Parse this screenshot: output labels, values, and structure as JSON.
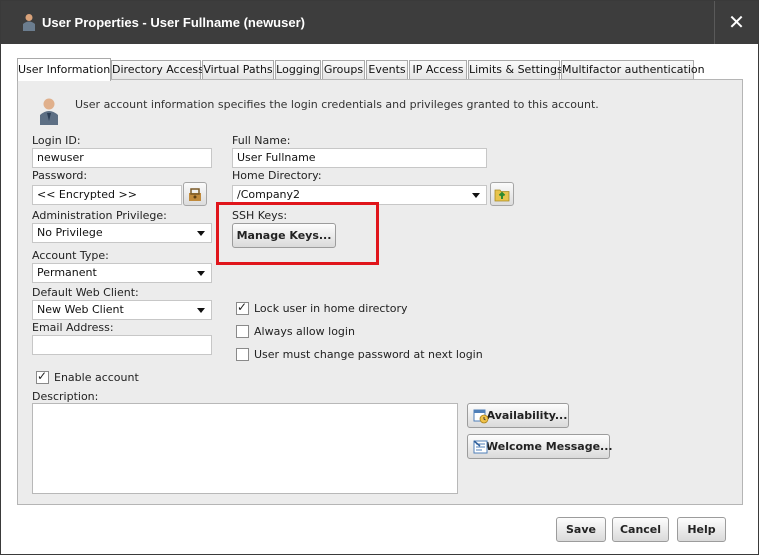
{
  "window": {
    "title": "User Properties - User Fullname (newuser)",
    "close_glyph": "✕"
  },
  "tabs": [
    {
      "label": "User Information",
      "active": true
    },
    {
      "label": "Directory Access"
    },
    {
      "label": "Virtual Paths"
    },
    {
      "label": "Logging"
    },
    {
      "label": "Groups"
    },
    {
      "label": "Events"
    },
    {
      "label": "IP Access"
    },
    {
      "label": "Limits & Settings"
    },
    {
      "label": "Multifactor authentication"
    }
  ],
  "info_text": "User account information specifies the login credentials and privileges granted to this account.",
  "form": {
    "login_id": {
      "label": "Login ID:",
      "value": "newuser"
    },
    "full_name": {
      "label": "Full Name:",
      "value": "User Fullname"
    },
    "password": {
      "label": "Password:",
      "value": "<< Encrypted >>"
    },
    "home_directory": {
      "label": "Home Directory:",
      "value": "/Company2"
    },
    "admin_privilege": {
      "label": "Administration Privilege:",
      "value": "No Privilege"
    },
    "ssh_keys": {
      "label": "SSH Keys:",
      "button": "Manage Keys..."
    },
    "account_type": {
      "label": "Account Type:",
      "value": "Permanent"
    },
    "default_web_client": {
      "label": "Default Web Client:",
      "value": "New Web Client"
    },
    "email": {
      "label": "Email Address:",
      "value": ""
    },
    "lock_home": {
      "label": "Lock user in home directory",
      "checked": true
    },
    "always_allow_login": {
      "label": "Always allow login",
      "checked": false
    },
    "must_change_password": {
      "label": "User must change password at next login",
      "checked": false
    },
    "enable_account": {
      "label": "Enable account",
      "checked": true
    },
    "description": {
      "label": "Description:",
      "value": ""
    }
  },
  "side_buttons": {
    "availability": "Availability...",
    "welcome_message": "Welcome Message..."
  },
  "footer": {
    "save": "Save",
    "cancel": "Cancel",
    "help": "Help"
  },
  "icons": {
    "title": "user-icon",
    "info": "user-info-icon",
    "password": "key-icon",
    "home": "folder-up-icon",
    "availability": "calendar-clock-icon",
    "welcome": "message-icon"
  },
  "colors": {
    "titlebar": "#3d3d3d",
    "panel": "#ececec",
    "highlight": "#e0151b"
  }
}
